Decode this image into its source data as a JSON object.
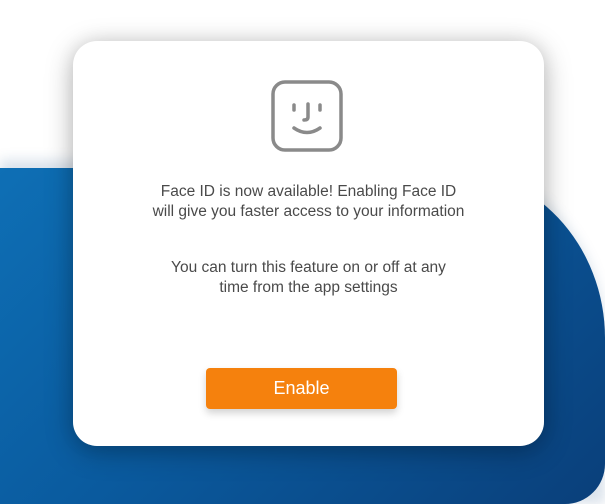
{
  "dialog": {
    "icon": "face-id-icon",
    "message_primary_line1": "Face ID is now available! Enabling Face ID",
    "message_primary_line2": "will give you faster access to your information",
    "message_secondary_line1": "You can turn this feature on or off at any",
    "message_secondary_line2": "time from the app settings",
    "enable_label": "Enable"
  },
  "colors": {
    "accent": "#f5810d",
    "background_blue": "#0a5a9e",
    "text": "#4a4a4a",
    "icon_stroke": "#8a8a8a"
  }
}
